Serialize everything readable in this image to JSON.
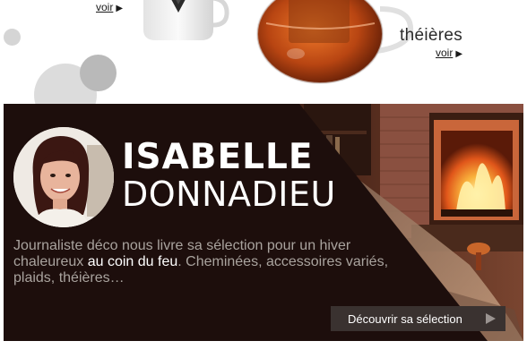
{
  "top": {
    "link_voir_1": "voir",
    "product_label": "théières",
    "link_voir_2": "voir"
  },
  "banner": {
    "first_name": "ISABELLE",
    "last_name": "DONNADIEU",
    "description_part1": "Journaliste déco nous livre sa sélection pour un hiver chaleureux ",
    "description_highlight": "au coin du feu",
    "description_part2": ". Cheminées, accessoires variés, plaids, théières…",
    "cta_label": "Découvrir sa sélection"
  },
  "colors": {
    "banner_bg": "#1d0e0c",
    "cta_bg": "#3a3230",
    "description_text": "#a9a39e",
    "fire_orange": "#f28a1e"
  },
  "icons": [
    "arrow-right-icon",
    "play-triangle-icon"
  ]
}
